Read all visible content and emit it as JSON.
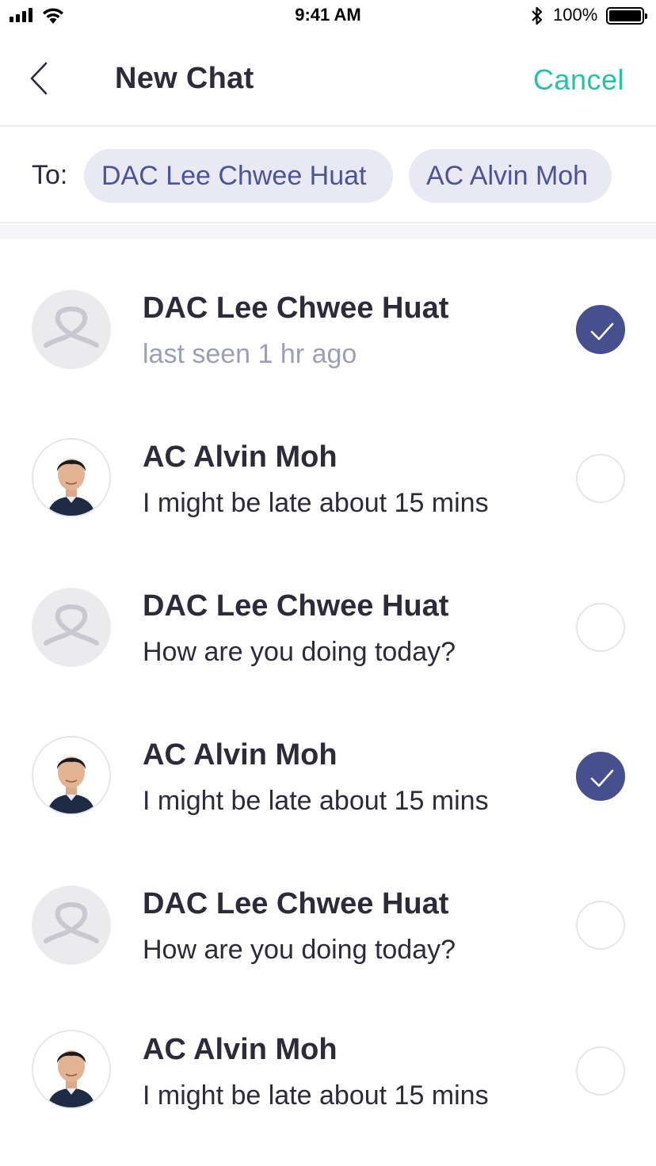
{
  "status_bar": {
    "time": "9:41 AM",
    "battery": "100%",
    "signal_icon": "cellular-signal-icon",
    "wifi_icon": "wifi-icon",
    "bluetooth_icon": "bluetooth-icon",
    "battery_icon": "battery-icon"
  },
  "nav": {
    "title": "New Chat",
    "cancel_label": "Cancel",
    "back_icon": "chevron-left-icon"
  },
  "recipients": {
    "to_label": "To:",
    "chips": [
      "DAC Lee Chwee Huat",
      "AC Alvin Moh"
    ]
  },
  "contacts": [
    {
      "name": "DAC Lee Chwee Huat",
      "subtitle": "last seen 1 hr ago",
      "avatar": "logo-avatar",
      "selected": true
    },
    {
      "name": "AC Alvin Moh",
      "subtitle": "I might be late about 15 mins",
      "avatar": "photo-avatar",
      "selected": false
    },
    {
      "name": "DAC Lee Chwee Huat",
      "subtitle": "How are you doing today?",
      "avatar": "logo-avatar",
      "selected": false
    },
    {
      "name": "AC Alvin Moh",
      "subtitle": "I might be late about 15 mins",
      "avatar": "photo-avatar",
      "selected": true
    },
    {
      "name": "DAC Lee Chwee Huat",
      "subtitle": "How are you doing today?",
      "avatar": "logo-avatar",
      "selected": false
    },
    {
      "name": "AC Alvin Moh",
      "subtitle": "I might be late about 15 mins",
      "avatar": "photo-avatar",
      "selected": false
    }
  ],
  "colors": {
    "accent_teal": "#27c1a4",
    "selected_indigo": "#46508f",
    "chip_bg": "#e9e9f3",
    "chip_text": "#4c5396",
    "muted_text": "#9a9fb4"
  }
}
